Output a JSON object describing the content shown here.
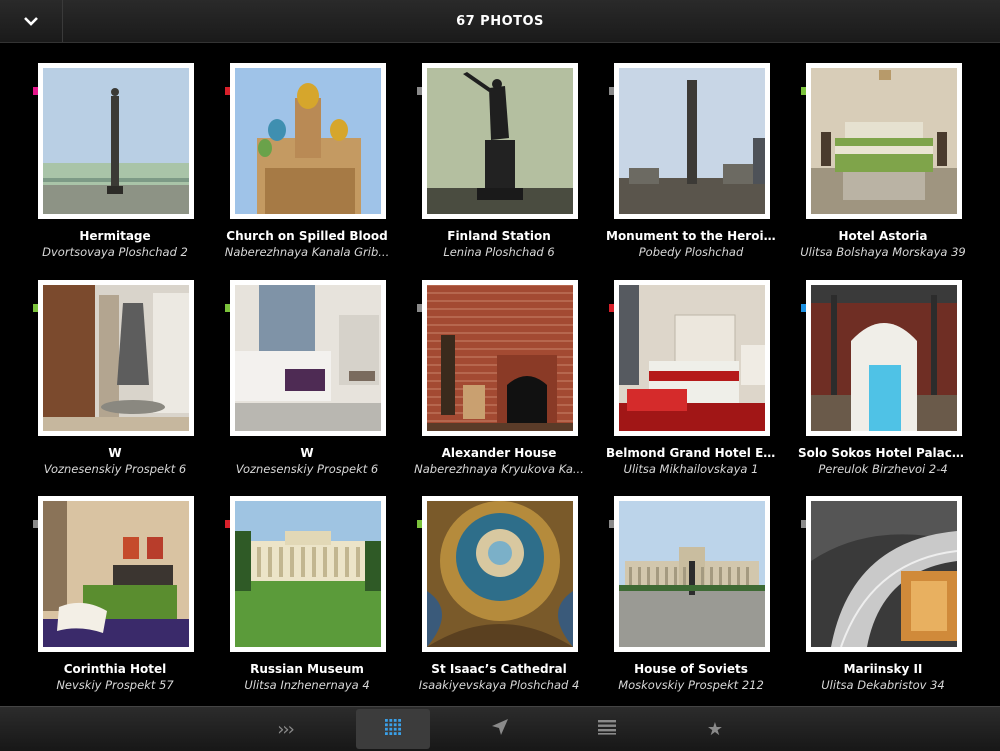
{
  "header": {
    "title": "67 PHOTOS"
  },
  "photos": [
    {
      "title": "Hermitage",
      "subtitle": "Dvortsovaya Ploshchad 2",
      "flag": "#e6168c",
      "scene": "column"
    },
    {
      "title": "Church on Spilled Blood",
      "subtitle": "Naberezhnaya Kanala Grib...",
      "flag": "#d8202a",
      "scene": "church"
    },
    {
      "title": "Finland Station",
      "subtitle": "Lenina Ploshchad 6",
      "flag": "#8a8a8a",
      "scene": "statue"
    },
    {
      "title": "Monument to the Heroic...",
      "subtitle": "Pobedy Ploshchad",
      "flag": "#8a8a8a",
      "scene": "obelisk"
    },
    {
      "title": "Hotel Astoria",
      "subtitle": "Ulitsa Bolshaya Morskaya 39",
      "flag": "#7bc23b",
      "scene": "bedroom"
    },
    {
      "title": "W",
      "subtitle": "Voznesenskiy Prospekt 6",
      "flag": "#7bc23b",
      "scene": "fireplace"
    },
    {
      "title": "W",
      "subtitle": "Voznesenskiy Prospekt 6",
      "flag": "#7bc23b",
      "scene": "bedroom2"
    },
    {
      "title": "Alexander House",
      "subtitle": "Naberezhnaya Kryukova Ka...",
      "flag": "#8a8a8a",
      "scene": "brick"
    },
    {
      "title": "Belmond Grand Hotel Eu...",
      "subtitle": "Ulitsa Mikhailovskaya 1",
      "flag": "#d8202a",
      "scene": "redbed"
    },
    {
      "title": "Solo Sokos Hotel Palace...",
      "subtitle": "Pereulok Birzhevoi 2-4",
      "flag": "#1a8fe0",
      "scene": "pool"
    },
    {
      "title": "Corinthia Hotel",
      "subtitle": "Nevskiy Prospekt 57",
      "flag": "#8a8a8a",
      "scene": "greenbed"
    },
    {
      "title": "Russian Museum",
      "subtitle": "Ulitsa Inzhenernaya 4",
      "flag": "#d8202a",
      "scene": "museum"
    },
    {
      "title": "St Isaac’s Cathedral",
      "subtitle": "Isaakiyevskaya Ploshchad 4",
      "flag": "#7bc23b",
      "scene": "dome"
    },
    {
      "title": "House of Soviets",
      "subtitle": "Moskovskiy Prospekt 212",
      "flag": "#8a8a8a",
      "scene": "soviets"
    },
    {
      "title": "Mariinsky II",
      "subtitle": "Ulitsa Dekabristov 34",
      "flag": "#8a8a8a",
      "scene": "mariinsky"
    }
  ],
  "tabs": [
    {
      "name": "tab-browse",
      "icon": "chevrons-icon",
      "glyph": "›››",
      "active": false
    },
    {
      "name": "tab-grid",
      "icon": "grid-icon",
      "glyph": "",
      "active": true
    },
    {
      "name": "tab-nearby",
      "icon": "location-arrow-icon",
      "glyph": "",
      "active": false
    },
    {
      "name": "tab-list",
      "icon": "list-icon",
      "glyph": "",
      "active": false
    },
    {
      "name": "tab-favorites",
      "icon": "star-icon",
      "glyph": "★",
      "active": false
    }
  ]
}
